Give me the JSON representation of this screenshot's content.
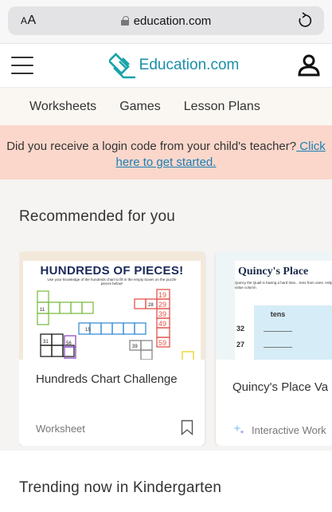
{
  "browser": {
    "aa_big": "A",
    "aa_small": "A",
    "url": "education.com"
  },
  "header": {
    "logo_text": "Education.com"
  },
  "nav": {
    "items": [
      {
        "label": "Worksheets"
      },
      {
        "label": "Games"
      },
      {
        "label": "Lesson Plans"
      }
    ]
  },
  "banner": {
    "text": "Did you receive a login code from your child's teacher?",
    "link": " Click here to get started."
  },
  "recommended": {
    "title": "Recommended for you",
    "cards": [
      {
        "title": "Hundreds Chart Challenge",
        "type": "Worksheet",
        "thumb_title": "HUNDREDS OF PIECES!",
        "thumb_sub": "Use your knowledge of the hundreds chart to fill in the empty boxes on the puzzle pieces below!"
      },
      {
        "title": "Quincy's Place Va",
        "type": "Interactive Work",
        "thumb_title": "Quincy's Place",
        "thumb_sub": "Quincy the Quail is having a hard time... tens from ones. Help him by writing e... correct place value column.",
        "col": "tens",
        "rows": [
          "32",
          "27"
        ]
      }
    ]
  },
  "trending": {
    "title": "Trending now in Kindergarten"
  }
}
